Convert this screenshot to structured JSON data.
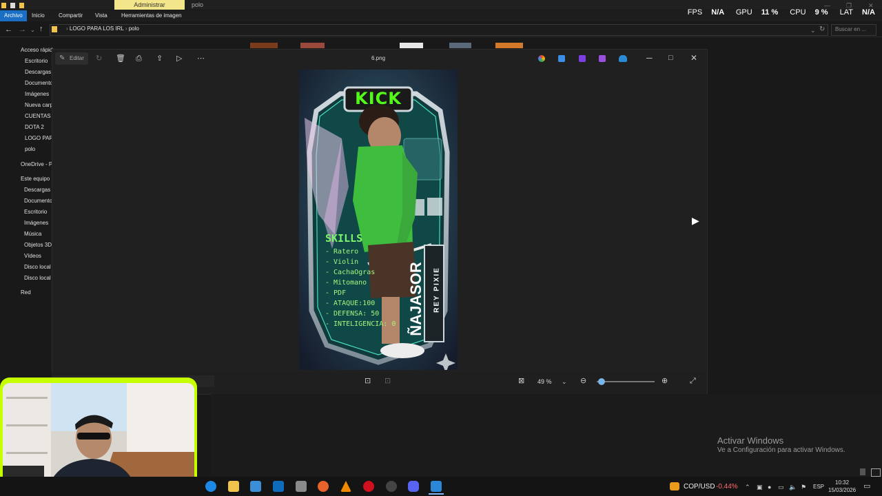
{
  "ribbon": {
    "admin_tab": "Administrar",
    "folder": "polo",
    "tabs": [
      "Archivo",
      "Inicio",
      "Compartir",
      "Vista",
      "Herramientas de imagen"
    ]
  },
  "overlay_stats": {
    "fps_label": "FPS",
    "fps_value": "N/A",
    "gpu_label": "GPU",
    "gpu_value": "11 %",
    "cpu_label": "CPU",
    "cpu_value": "9 %",
    "lat_label": "LAT",
    "lat_value": "N/A"
  },
  "address": {
    "crumbs": [
      "LOGO PARA LOS IRL",
      "polo"
    ],
    "search_placeholder": "Buscar en ..."
  },
  "nav_pane": {
    "quick_access": "Acceso rápido",
    "quick_items": [
      "Escritorio",
      "Descargas",
      "Documentos",
      "Imágenes",
      "Nueva carpeta",
      "CUENTAS",
      "DOTA 2",
      "LOGO PARA LOS IRL",
      "polo"
    ],
    "onedrive": "OneDrive - Personal",
    "this_pc": "Este equipo",
    "pc_items": [
      "Descargas",
      "Documentos",
      "Escritorio",
      "Imágenes",
      "Música",
      "Objetos 3D",
      "Vídeos",
      "Disco local (C:)",
      "Disco local (D:)"
    ],
    "network": "Red"
  },
  "viewer": {
    "edit_label": "Editar",
    "file_name": "6.png",
    "zoom": "49 %"
  },
  "card": {
    "brand": "KICK",
    "skills_title": "SKILLS",
    "skills": [
      "- Ratero",
      "- Violin",
      "- CachaOgras",
      "- Mitomano",
      "- PDF",
      "- ATAQUE:100",
      "- DEFENSA: 50",
      "- INTELIGENCIA: 0"
    ],
    "name": "ÑAJASOR",
    "subtitle": "REY PIXIE"
  },
  "watermark": {
    "line1": "Activar Windows",
    "line2": "Ve a Configuración para activar Windows."
  },
  "taskbar": {
    "ticker": "COP/USD",
    "ticker_change": "-0.44%",
    "lang": "ESP",
    "time": "10:32",
    "date": "15/03/2026"
  },
  "colors": {
    "accent": "#1a6fc4",
    "admin_tab": "#f3e58a",
    "cam_border": "#c6ff00",
    "kick_green": "#53fc18"
  }
}
